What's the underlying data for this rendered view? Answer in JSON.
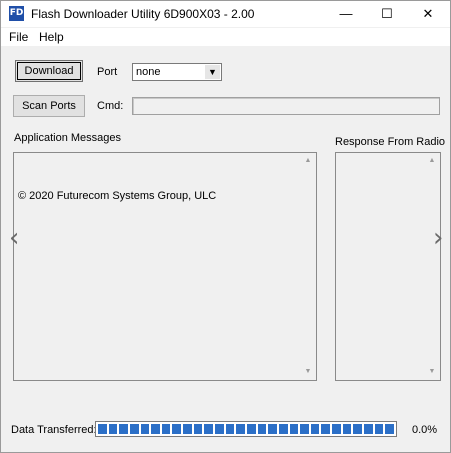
{
  "window": {
    "title": "Flash Downloader Utility 6D900X03 - 2.00",
    "icon_text": "FD",
    "controls": {
      "minimize": "—",
      "maximize": "☐",
      "close": "✕"
    }
  },
  "menu": {
    "items": [
      "File",
      "Help"
    ]
  },
  "toolbar": {
    "download_label": "Download",
    "scan_ports_label": "Scan Ports",
    "port_label": "Port",
    "port_value": "none",
    "cmd_label": "Cmd:",
    "cmd_value": ""
  },
  "messages": {
    "app_header": "Application Messages",
    "radio_header": "Response From Radio",
    "lines": [
      "© 2020 Futurecom Systems Group, ULC"
    ]
  },
  "nav": {
    "left": "‹",
    "right": "›"
  },
  "status": {
    "data_transferred_label": "Data Transferred:",
    "percent_text": "0.0%",
    "progress_fraction": 0.0
  },
  "colors": {
    "progress_fill": "#2b6fc7",
    "icon_bg": "#1f4fa8"
  }
}
